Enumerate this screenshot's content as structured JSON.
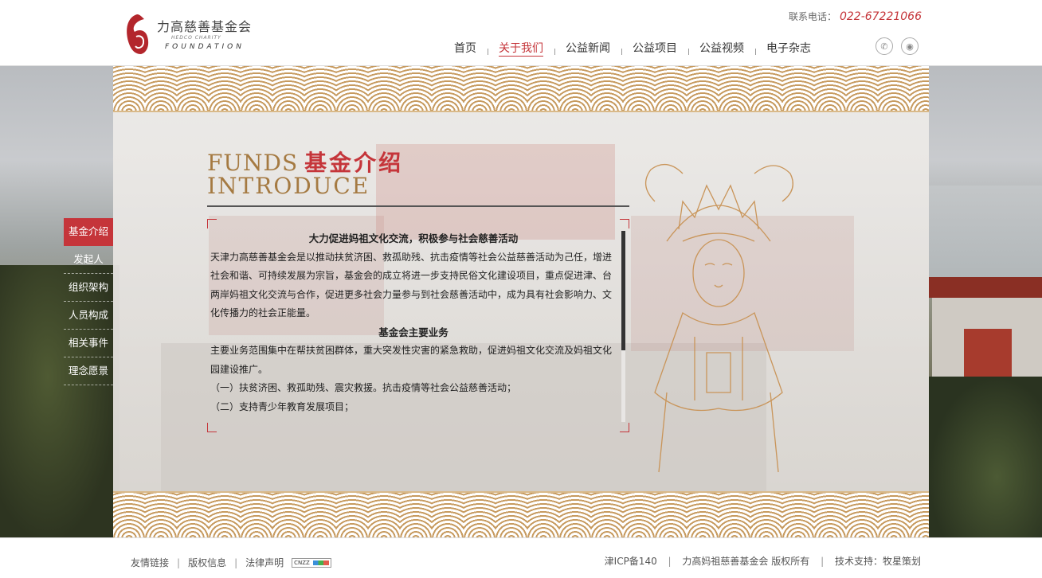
{
  "header": {
    "logo": {
      "cn": "力高慈善基金会",
      "small": "HEDCO CHARITY",
      "en": "FOUNDATION"
    },
    "contact_label": "联系电话：",
    "contact_phone": "022-67221066",
    "nav": [
      {
        "label": "首页"
      },
      {
        "label": "关于我们"
      },
      {
        "label": "公益新闻"
      },
      {
        "label": "公益项目"
      },
      {
        "label": "公益视频"
      },
      {
        "label": "电子杂志"
      }
    ],
    "social": {
      "wechat_glyph": "✆",
      "weibo_glyph": "◉"
    }
  },
  "section": {
    "title_en1": "FUNDS",
    "title_cn": "基金介绍",
    "title_en2": "INTRODUCE"
  },
  "sidebar": {
    "items": [
      {
        "label": "基金介绍"
      },
      {
        "label": "发起人"
      },
      {
        "label": "组织架构"
      },
      {
        "label": "人员构成"
      },
      {
        "label": "相关事件"
      },
      {
        "label": "理念愿景"
      }
    ]
  },
  "content": {
    "heading1": "大力促进妈祖文化交流，积极参与社会慈善活动",
    "para1": "天津力高慈善基金会是以推动扶贫济困、救孤助残、抗击疫情等社会公益慈善活动为己任，增进社会和谐、可持续发展为宗旨，基金会的成立将进一步支持民俗文化建设项目，重点促进津、台两岸妈祖文化交流与合作，促进更多社会力量参与到社会慈善活动中，成为具有社会影响力、文化传播力的社会正能量。",
    "heading2": "基金会主要业务",
    "para2": "主要业务范围集中在帮扶贫困群体，重大突发性灾害的紧急救助，促进妈祖文化交流及妈祖文化园建设推广。",
    "item1": "（一）扶贫济困、救孤助残、震灾救援。抗击疫情等社会公益慈善活动；",
    "item2": "（二）支持青少年教育发展项目；"
  },
  "footer": {
    "links": [
      "友情链接",
      "版权信息",
      "法律声明"
    ],
    "cnzz": "CNZZ",
    "icp": "津ICP备140",
    "org": "力高妈祖慈善基金会",
    "rights": "版权所有",
    "support": "技术支持：牧星策划"
  },
  "colors": {
    "accent": "#c5353a",
    "gold": "#a57a42"
  }
}
